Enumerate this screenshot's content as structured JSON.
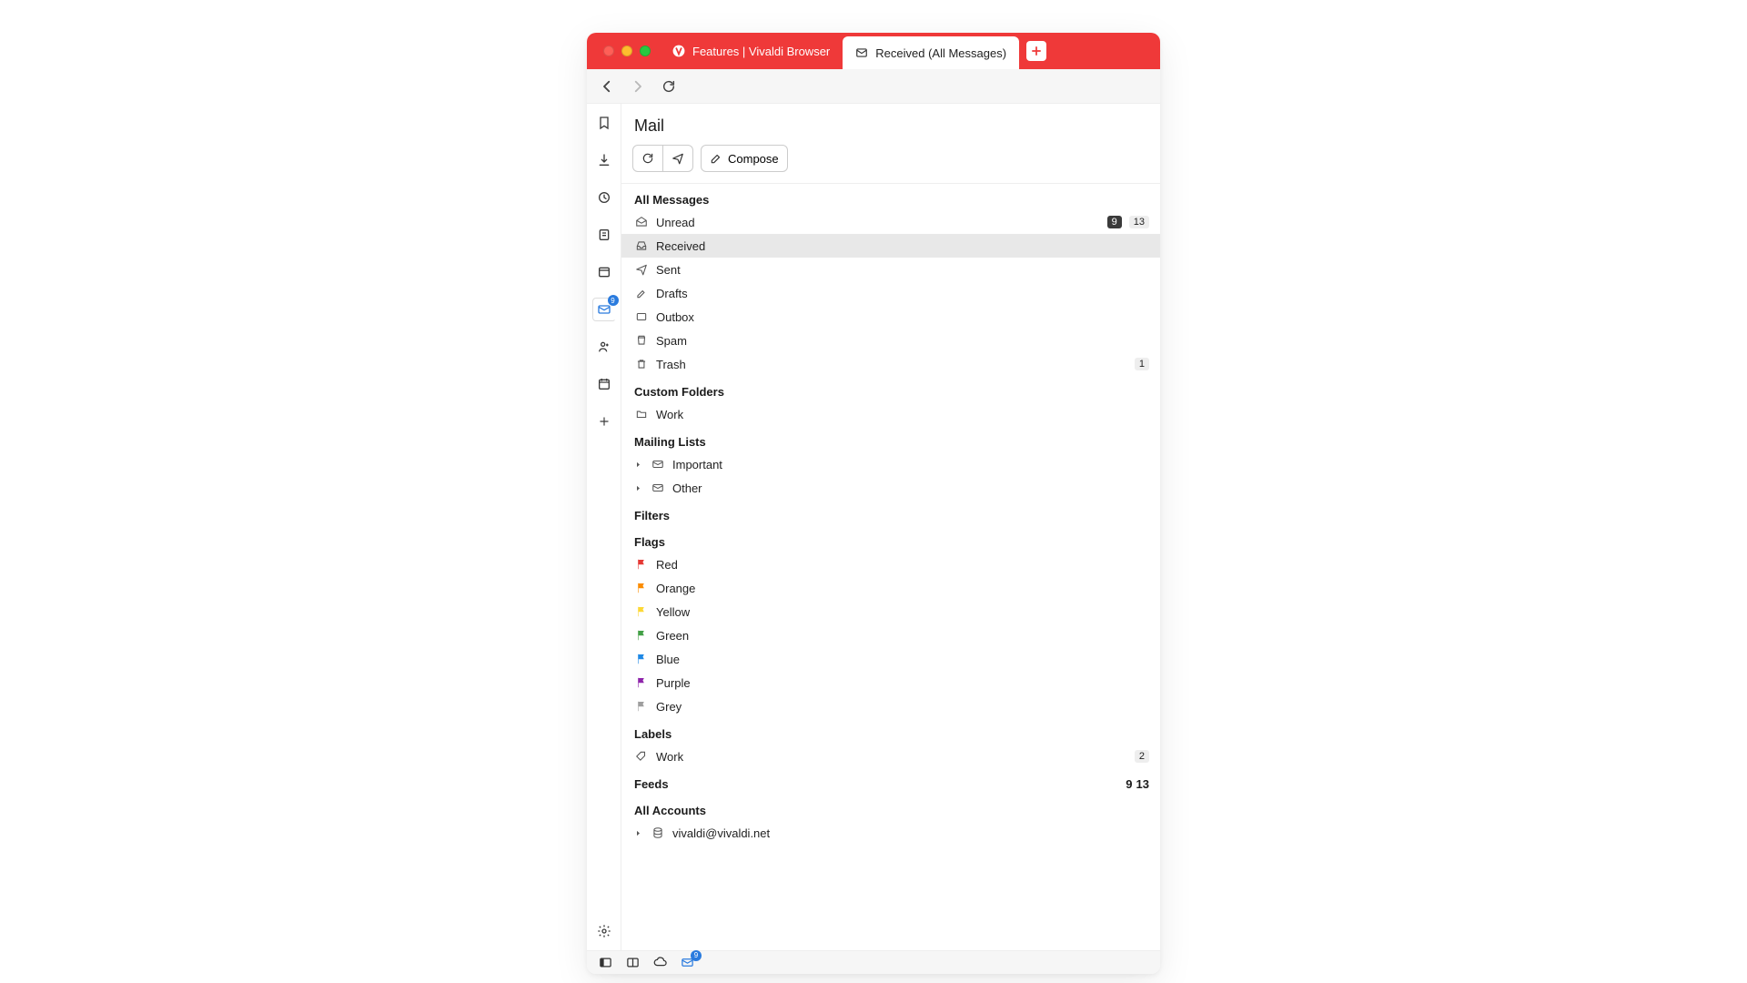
{
  "tabs": {
    "inactive": {
      "label": "Features | Vivaldi Browser"
    },
    "active": {
      "label": "Received (All Messages)"
    }
  },
  "sidebar_badge": "9",
  "panel": {
    "title": "Mail",
    "compose": "Compose"
  },
  "sections": {
    "all_messages": "All Messages",
    "custom_folders": "Custom Folders",
    "mailing_lists": "Mailing Lists",
    "filters": "Filters",
    "flags": "Flags",
    "labels": "Labels",
    "feeds": "Feeds",
    "all_accounts": "All Accounts"
  },
  "folders": {
    "unread": {
      "label": "Unread",
      "badge_dark": "9",
      "badge_light": "13"
    },
    "received": {
      "label": "Received"
    },
    "sent": {
      "label": "Sent"
    },
    "drafts": {
      "label": "Drafts"
    },
    "outbox": {
      "label": "Outbox"
    },
    "spam": {
      "label": "Spam"
    },
    "trash": {
      "label": "Trash",
      "badge_light": "1"
    }
  },
  "custom_folders": [
    {
      "label": "Work"
    }
  ],
  "mailing_lists": [
    {
      "label": "Important"
    },
    {
      "label": "Other"
    }
  ],
  "flags": [
    {
      "label": "Red",
      "color": "#e53935"
    },
    {
      "label": "Orange",
      "color": "#fb8c00"
    },
    {
      "label": "Yellow",
      "color": "#fdd835"
    },
    {
      "label": "Green",
      "color": "#43a047"
    },
    {
      "label": "Blue",
      "color": "#1e88e5"
    },
    {
      "label": "Purple",
      "color": "#8e24aa"
    },
    {
      "label": "Grey",
      "color": "#9e9e9e"
    }
  ],
  "labels": [
    {
      "label": "Work",
      "count": "2"
    }
  ],
  "feeds": {
    "badge_dark": "9",
    "badge_light": "13"
  },
  "accounts": [
    {
      "label": "vivaldi@vivaldi.net"
    }
  ],
  "statusbar_badge": "9"
}
